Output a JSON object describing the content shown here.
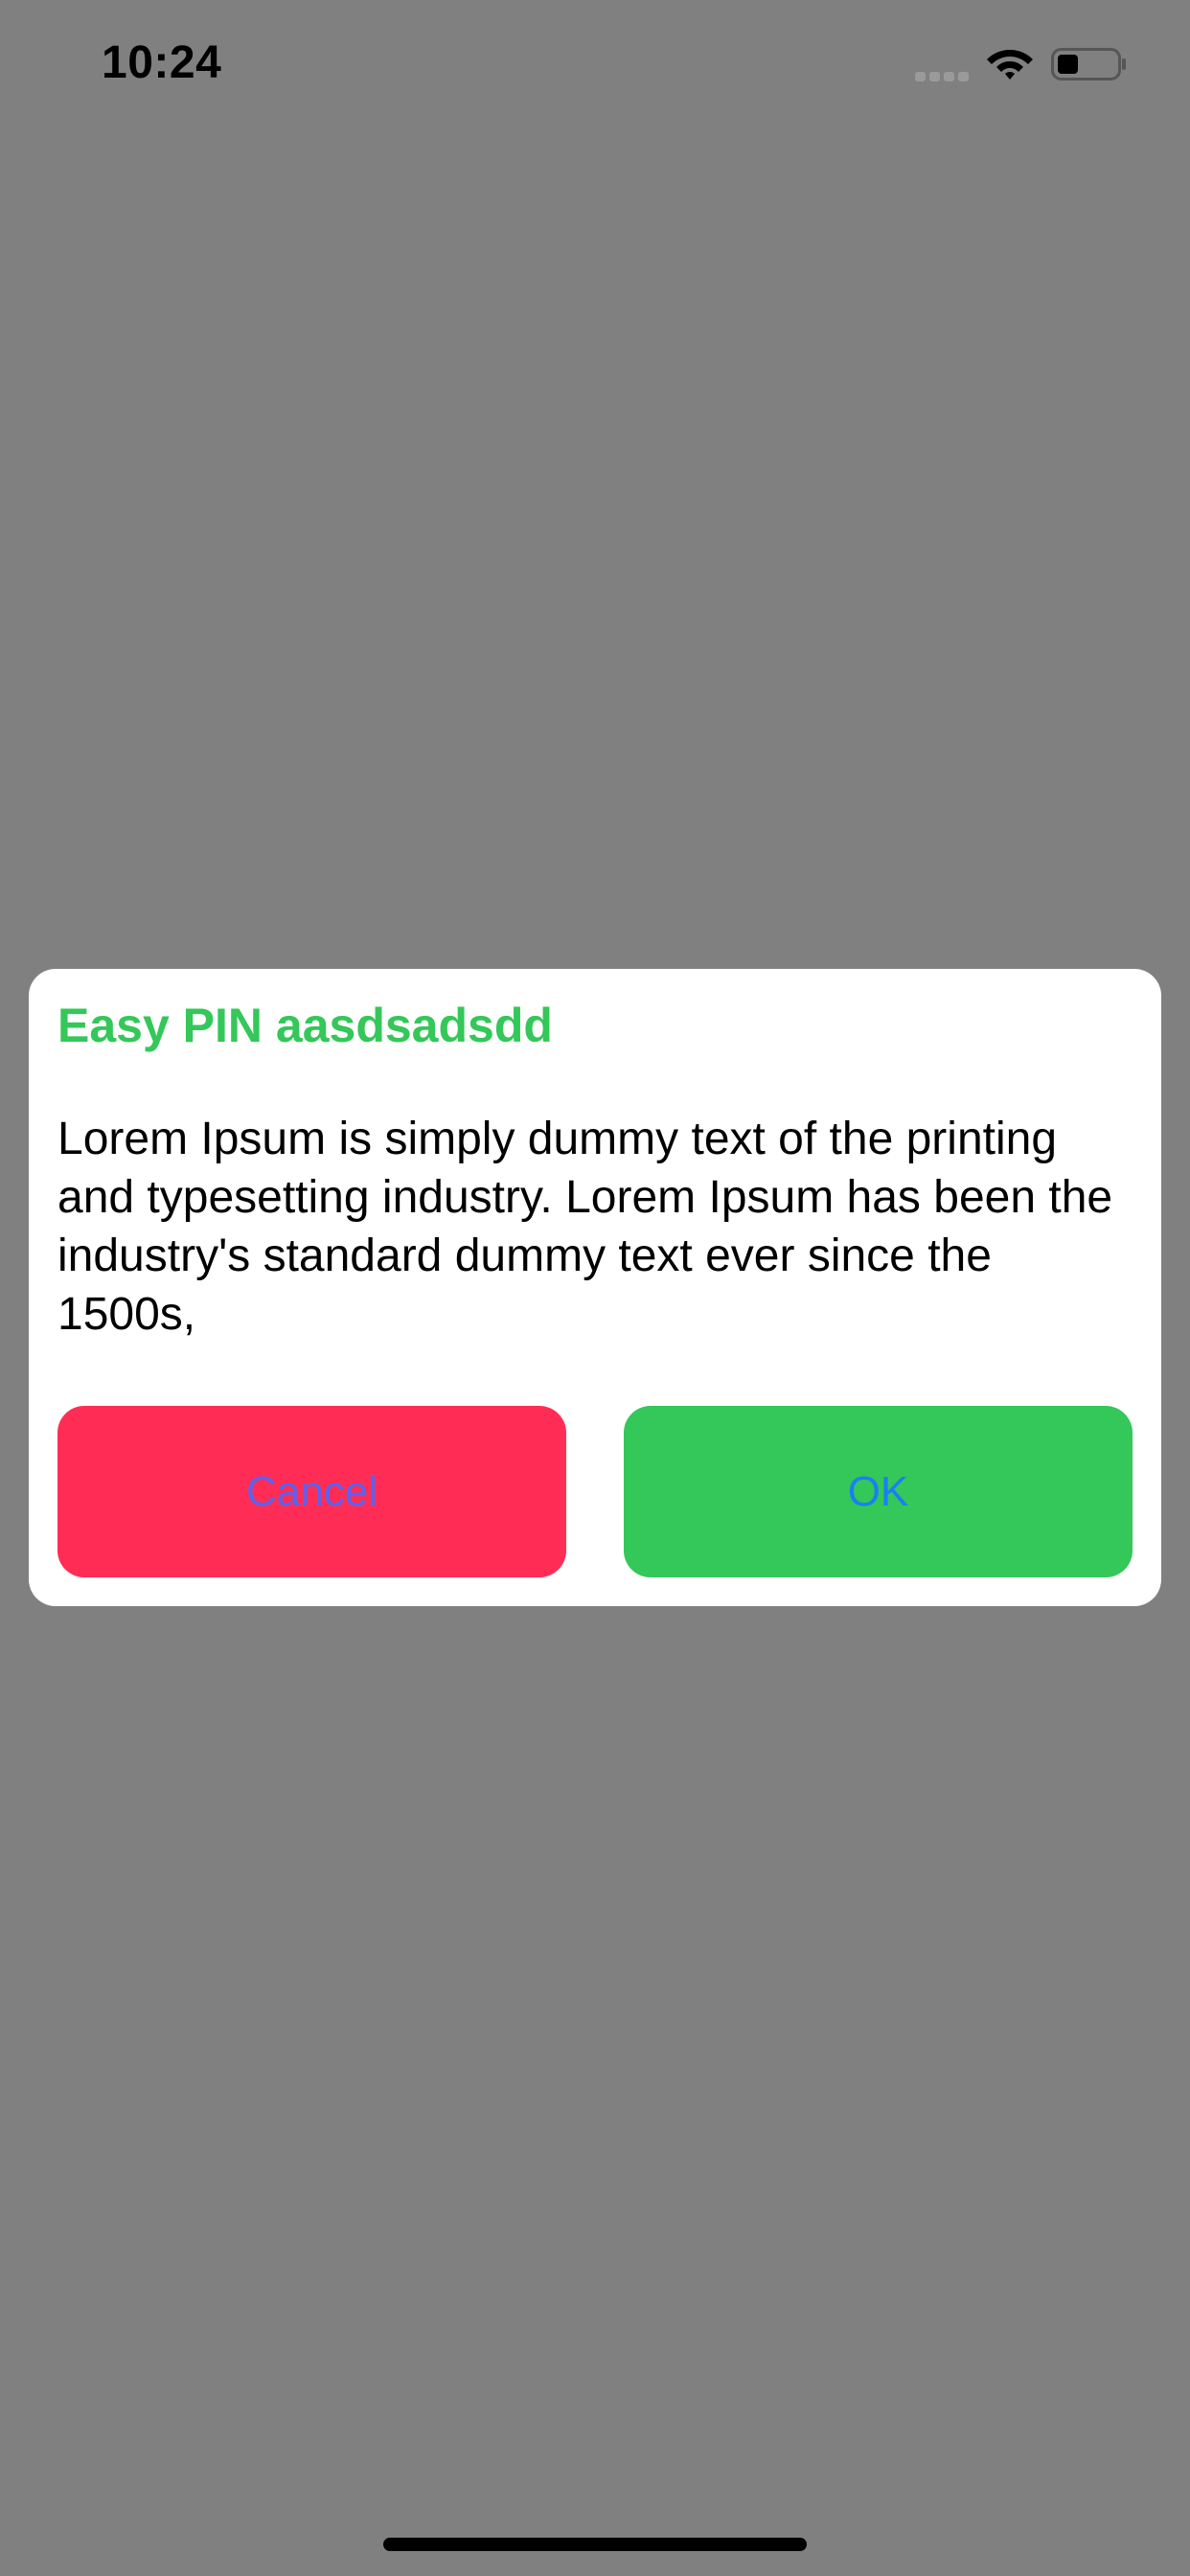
{
  "status_bar": {
    "time": "10:24",
    "signal_icon": "cellular-signal-icon",
    "wifi_icon": "wifi-icon",
    "battery_icon": "battery-icon",
    "battery_level": 0.35
  },
  "dialog": {
    "title": "Easy PIN aasdsadsdd",
    "message": "Lorem Ipsum is simply dummy text of the printing and typesetting industry. Lorem Ipsum has been the industry's standard dummy text ever since the 1500s,",
    "cancel_label": "Cancel",
    "ok_label": "OK"
  },
  "colors": {
    "backdrop": "#808080",
    "title": "#34c759",
    "cancel_button": "#ff2d55",
    "ok_button": "#34c759",
    "button_text": "#2f7ff7"
  }
}
